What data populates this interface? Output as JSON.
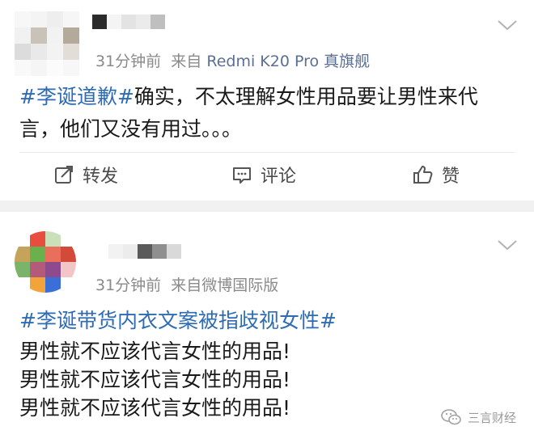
{
  "post1": {
    "meta_time": "31分钟前",
    "meta_source": "来自",
    "meta_device": "Redmi K20 Pro 真旗舰",
    "topic": "#李诞道歉#",
    "text": "确实，不太理解女性用品要让男性来代言，他们又没有用过。。。",
    "actions": {
      "repost": "转发",
      "comment": "评论",
      "like": "赞"
    },
    "icons": {
      "repost": "repost-icon",
      "comment": "comment-icon",
      "like": "thumbs-up-icon",
      "menu": "chevron-down-icon"
    }
  },
  "post2": {
    "meta_time": "31分钟前",
    "meta_source": "来自微博国际版",
    "topic": "#李诞带货内衣文案被指歧视女性#",
    "lines": [
      "男性就不应该代言女性的用品!",
      "男性就不应该代言女性的用品!",
      "男性就不应该代言女性的用品!"
    ],
    "icons": {
      "menu": "chevron-down-icon"
    }
  },
  "watermark": {
    "text": "三言财经",
    "icon": "wechat-icon"
  },
  "colors": {
    "topic": "#2e6bb5",
    "meta": "#8a8a8a",
    "device": "#5b6f95",
    "background": "#f1f1f1"
  }
}
